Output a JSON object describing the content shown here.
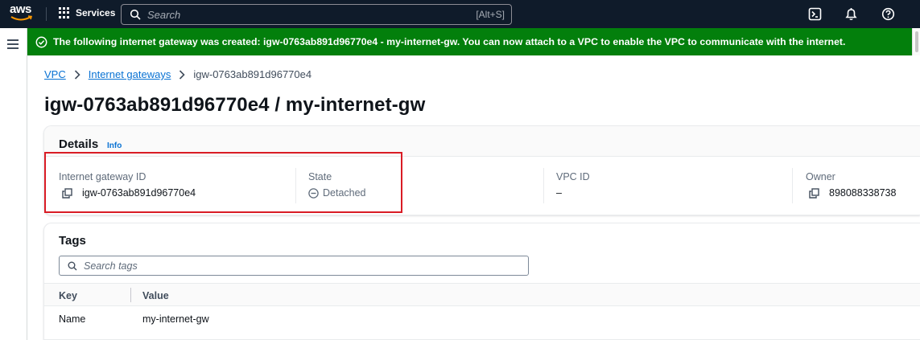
{
  "topnav": {
    "logo_text": "aws",
    "services_label": "Services",
    "search_placeholder": "Search",
    "search_shortcut": "[Alt+S]",
    "icons": [
      "cloudshell-icon",
      "notifications-icon",
      "help-icon"
    ]
  },
  "flash": {
    "message": "The following internet gateway was created: igw-0763ab891d96770e4 - my-internet-gw. You can now attach to a VPC to enable the VPC to communicate with the internet.",
    "color": "#037f0c"
  },
  "breadcrumb": {
    "items": [
      "VPC",
      "Internet gateways"
    ],
    "current": "igw-0763ab891d96770e4"
  },
  "page_title": "igw-0763ab891d96770e4 / my-internet-gw",
  "details": {
    "title": "Details",
    "info_label": "Info",
    "fields": [
      {
        "label": "Internet gateway ID",
        "value": "igw-0763ab891d96770e4"
      },
      {
        "label": "State",
        "value": "Detached"
      },
      {
        "label": "VPC ID",
        "value": "–"
      },
      {
        "label": "Owner",
        "value": "898088338738"
      }
    ]
  },
  "tags": {
    "title": "Tags",
    "search_placeholder": "Search tags",
    "columns": [
      "Key",
      "Value"
    ],
    "rows": [
      {
        "key": "Name",
        "value": "my-internet-gw"
      }
    ]
  },
  "colors": {
    "nav_bg": "#0f1b2a",
    "link": "#0972d3",
    "highlight_border": "#d91c25"
  }
}
